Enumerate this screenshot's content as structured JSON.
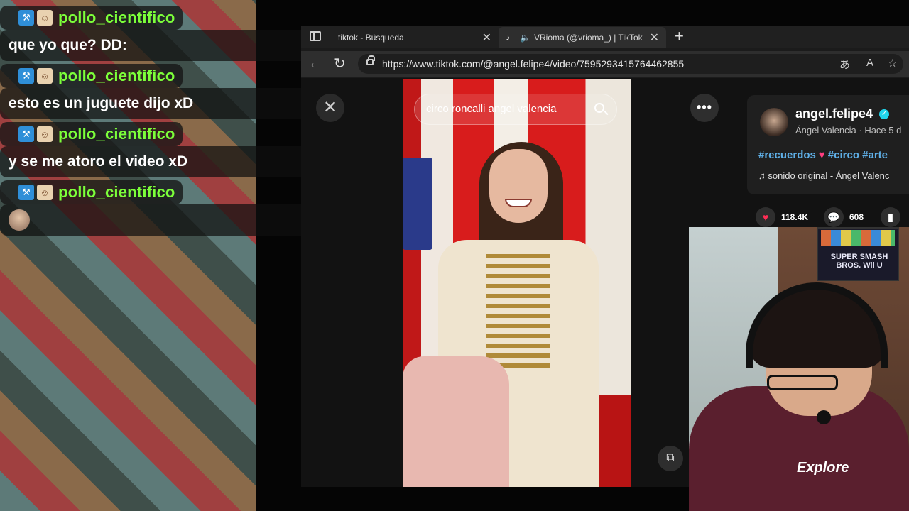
{
  "chat": {
    "messages": [
      {
        "user": "pollo_cientifico",
        "text": "que yo que? DD:"
      },
      {
        "user": "pollo_cientifico",
        "text": "esto es un juguete dijo xD"
      },
      {
        "user": "pollo_cientifico",
        "text": "y se me atoro el video xD"
      },
      {
        "user": "pollo_cientifico",
        "text": ""
      }
    ]
  },
  "browser": {
    "tabs": [
      {
        "title": "tiktok - Búsqueda"
      },
      {
        "title": "VRioma (@vrioma_) | TikTok"
      }
    ],
    "url": "https://www.tiktok.com/@angel.felipe4/video/7595293415764462855"
  },
  "video": {
    "search_text": "circo roncalli angel valencia"
  },
  "info": {
    "author": "angel.felipe4",
    "subtitle": "Ángel Valencia · Hace 5 d",
    "tag1": "#recuerdos",
    "tag2": "#circo",
    "tag3": "#arte",
    "sound": "sonido original - Ángel Valenc",
    "likes": "118.4K",
    "comments": "608"
  },
  "webcam": {
    "poster_text": "SUPER SMASH BROS. Wii U",
    "shirt_text": "Explore"
  },
  "colors": {
    "username": "#7cff3a",
    "hashtag": "#5fb0e8",
    "like": "#ff2d55"
  }
}
